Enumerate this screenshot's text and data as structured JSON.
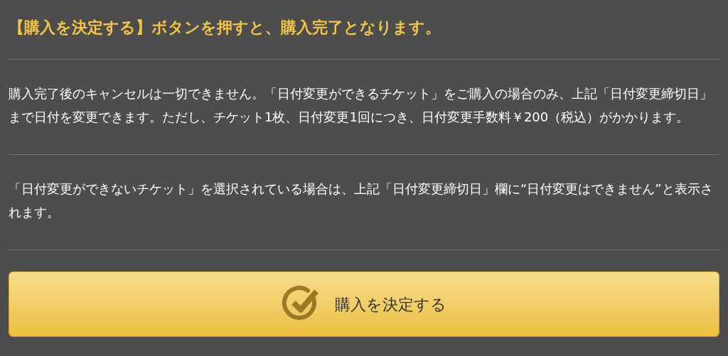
{
  "heading": "【購入を決定する】ボタンを押すと、購入完了となります。",
  "paragraphs": [
    "購入完了後のキャンセルは一切できません。「日付変更ができるチケット」をご購入の場合のみ、上記「日付変更締切日」まで日付を変更できます。ただし、チケット1枚、日付変更1回につき、日付変更手数料￥200（税込）がかかります。",
    "「日付変更ができないチケット」を選択されている場合は、上記「日付変更締切日」欄に“日付変更はできません”と表示されます。"
  ],
  "button": {
    "label": "購入を決定する"
  }
}
